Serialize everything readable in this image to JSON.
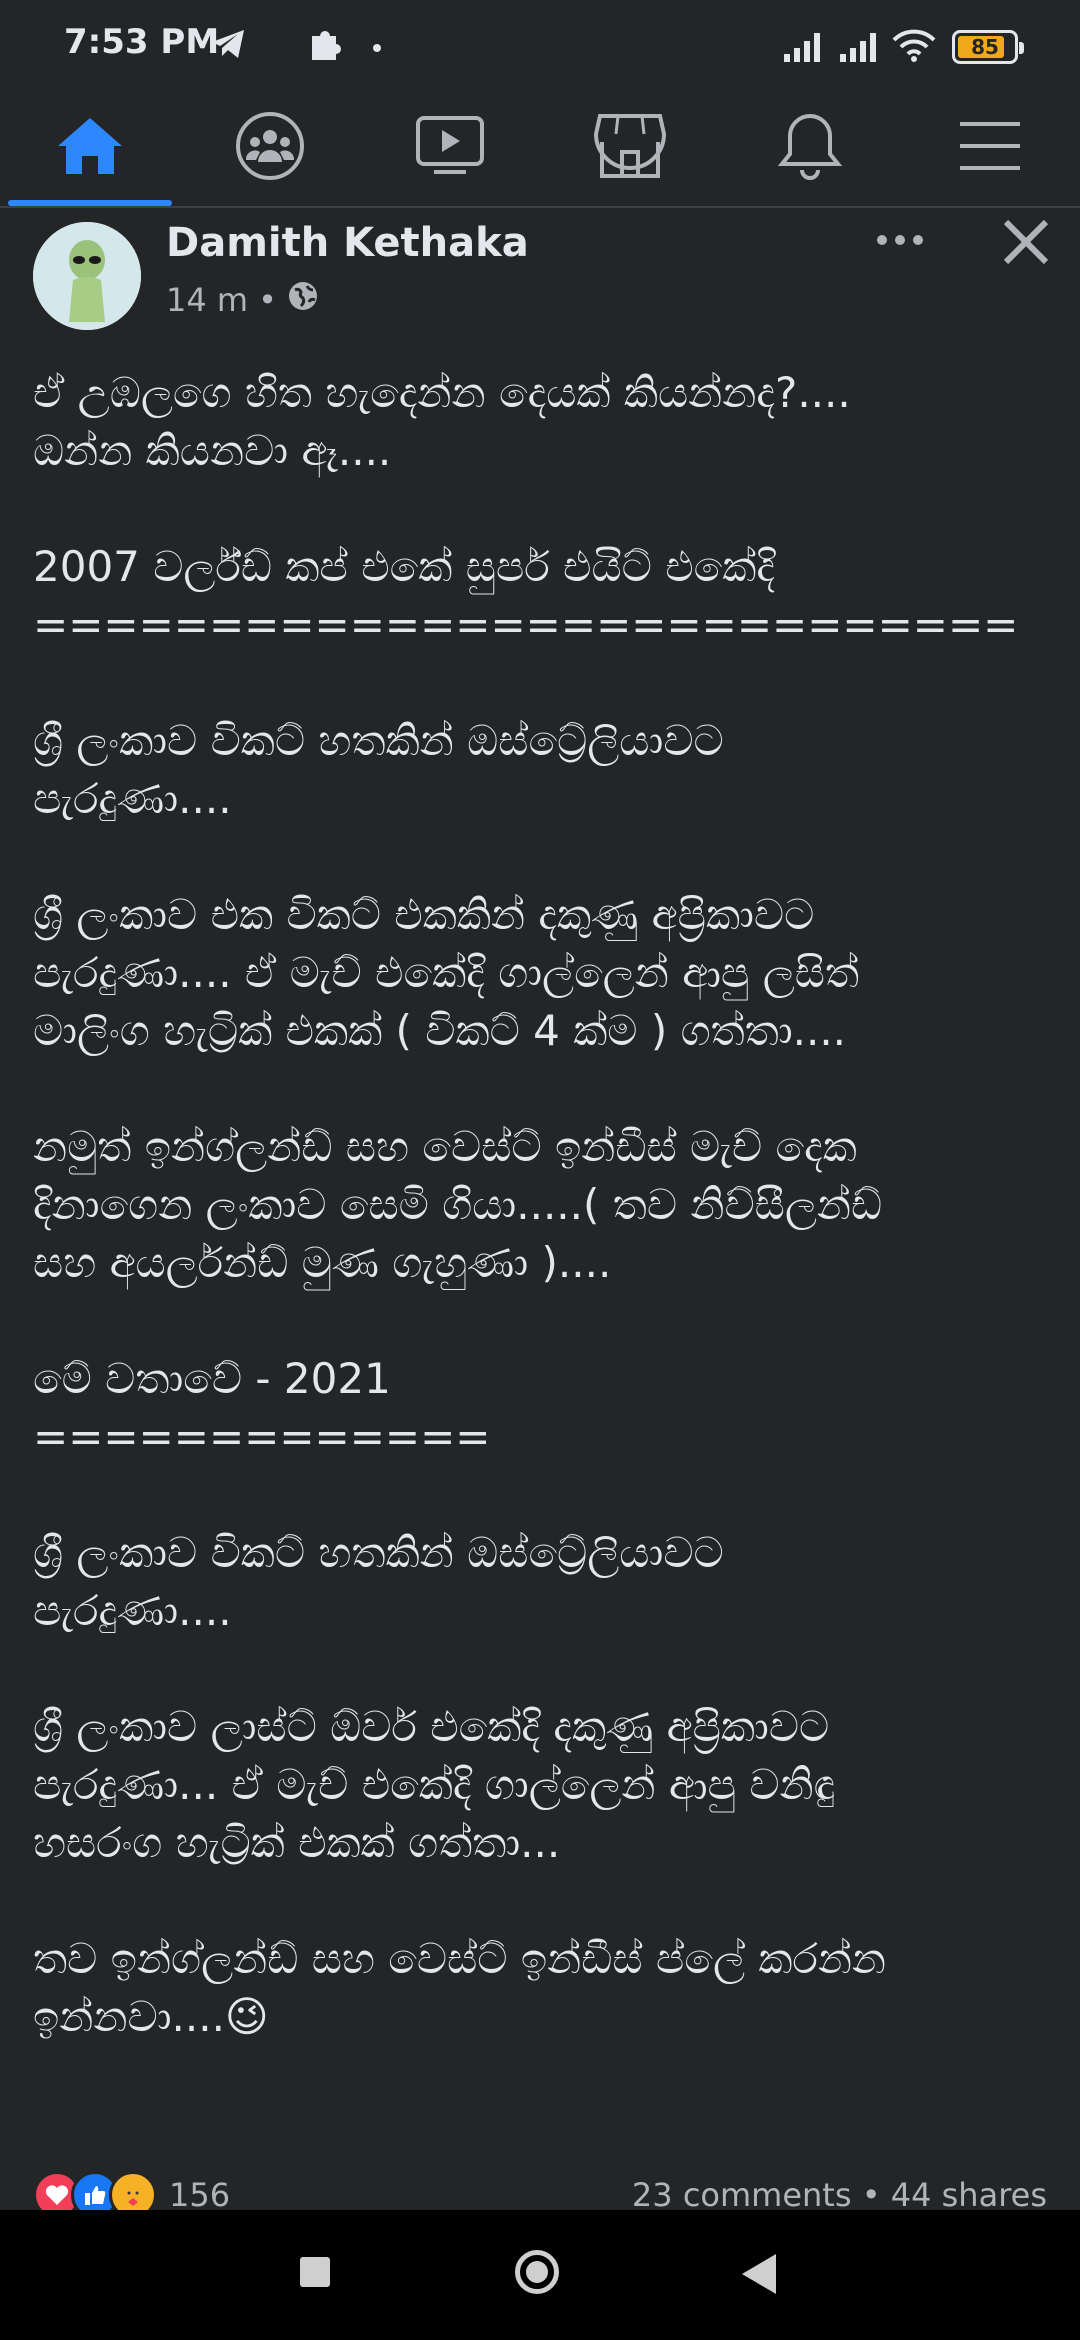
{
  "status_bar": {
    "time": "7:53 PM",
    "battery_level": "85"
  },
  "nav": {
    "tabs": [
      "home-icon",
      "groups-icon",
      "watch-icon",
      "marketplace-icon",
      "notifications-icon",
      "menu-icon"
    ],
    "active_color": "#2d88ff"
  },
  "post": {
    "author": "Damith Kethaka",
    "time": "14 m",
    "separator": "•",
    "paragraphs": [
      "ඒ උඹලගෙ හිත හැදෙන්න දෙයක් කියන්නද?....\nඔන්න කියනවා ඈ....",
      "2007 වර්ල්ඩ් කප් එකේ සුපර් එයිට් එකේදි\n============================",
      "ශ්‍රී ලංකාව විකට් හතකින් ඔස්ට්‍රේලියාවට\nපැරදුණා....",
      "ශ්‍රී ලංකාව එක විකට් එකකින් දකුණු අප්‍රිකාවට\nපැරදුණා.... ඒ මැච් එකේදි ගාල්ලෙන් ආපු ලසිත්\nමාලිංග හැට්‍රික් එකක් ( විකට් 4 ක්ම ) ගත්තා....",
      "නමුත් ඉන්ග්ලන්ඩ් සහ වෙස්ට් ඉන්ඩීස් මැච් දෙක\nදිනාගෙන ලංකාව සෙමි ගියා.....( තව නිව්සීලන්ඩ්\nසහ අයර්ලන්ඩ් මුණ ගැහුණා )....",
      "මේ වතාවේ - 2021\n=============",
      "ශ්‍රී ලංකාව විකට් හතකින් ඔස්ට්‍රේලියාවට\nපැරදුණා....",
      "ශ්‍රී ලංකාව ලාස්ට් ඕවර් එකේදි දකුණු අප්‍රිකාවට\nපැරදුණා... ඒ මැච් එකේදි ගාල්ලෙන් ආපු වනිඳු\nහසරංග හැට්‍රික් එකක් ගත්තා...",
      "තව ඉන්ග්ලන්ඩ් සහ වෙස්ට් ඉන්ඩීස් ප්ලේ කරන්න\nඉන්නවා....😉"
    ],
    "reactions": [
      "love-reaction-icon",
      "like-reaction-icon",
      "care-reaction-icon"
    ],
    "reaction_count": "156",
    "comments": "23 comments",
    "shares": "44 shares",
    "stats_separator": "•"
  }
}
